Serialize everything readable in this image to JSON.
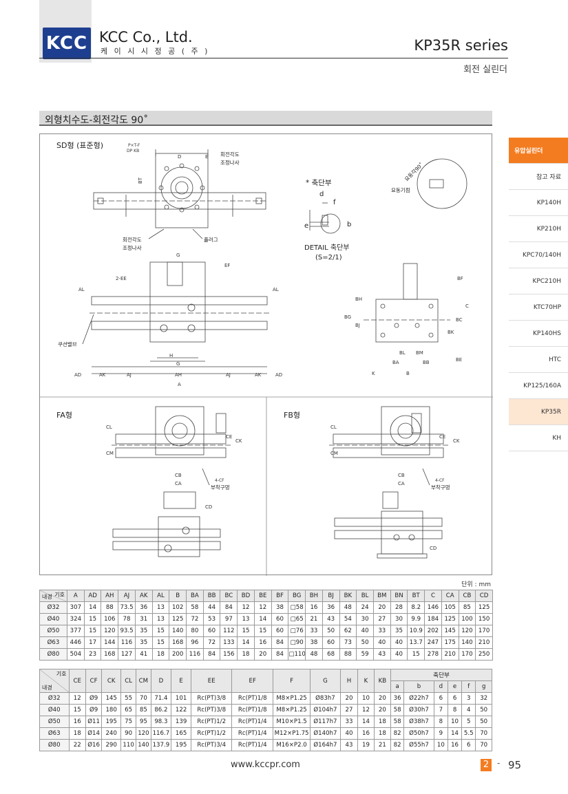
{
  "header": {
    "logo_text": "KCC",
    "company_name": "KCC Co., Ltd.",
    "company_korean": "케 이 시 시 정 공 ( 주 )",
    "series": "KP35R series",
    "series_sub": "회전 실린더"
  },
  "section_title": "외형치수도-회전각도 90˚",
  "drawing": {
    "sd_label": "SD형 (표준형)",
    "fa_label": "FA형",
    "fb_label": "FB형",
    "rot_adj_screw_1": "회전각도",
    "rot_adj_screw_2": "조정나사",
    "plug": "플러그",
    "cushion_valve": "쿠션밸브",
    "shaft_end": "* 축단부",
    "detail_1": "DETAIL 축단부",
    "detail_2": "(S=2/1)",
    "swing_range": "요동각90˚",
    "swing_ref": "요동기점",
    "mount_hole": "부착구멍",
    "dims": {
      "A": "A",
      "AD": "AD",
      "AK": "AK",
      "AJ": "AJ",
      "AH": "AH",
      "AL": "AL",
      "B": "B",
      "BA": "BA",
      "BB": "BB",
      "BC": "BC",
      "BD": "BD",
      "BE": "BE",
      "BF": "BF",
      "BG": "BG",
      "BH": "BH",
      "BJ": "BJ",
      "BK": "BK",
      "BL": "BL",
      "BM": "BM",
      "BN": "BN",
      "BT": "BT",
      "C": "C",
      "CA": "CA",
      "CB": "CB",
      "CD": "CD",
      "CE": "CE",
      "CF": "CF",
      "CK": "CK",
      "CL": "CL",
      "CM": "CM",
      "D": "D",
      "E": "E",
      "EE": "2-EE",
      "EF": "EF",
      "G": "G",
      "H": "H",
      "K": "K",
      "KB": "KB",
      "a": "a",
      "b": "b",
      "d": "d",
      "e": "e",
      "f": "f",
      "pcd": "P×T-F",
      "dp": "DP KB",
      "fourcf": "4-CF"
    }
  },
  "unit_label": "단위 : mm",
  "table1": {
    "corner_top": "기호",
    "corner_bottom": "내경",
    "headers": [
      "A",
      "AD",
      "AH",
      "AJ",
      "AK",
      "AL",
      "B",
      "BA",
      "BB",
      "BC",
      "BD",
      "BE",
      "BF",
      "BG",
      "BH",
      "BJ",
      "BK",
      "BL",
      "BM",
      "BN",
      "BT",
      "C",
      "CA",
      "CB",
      "CD"
    ],
    "rows": [
      [
        "Ø32",
        "307",
        "14",
        "88",
        "73.5",
        "36",
        "13",
        "102",
        "58",
        "44",
        "84",
        "12",
        "12",
        "38",
        "□58",
        "16",
        "36",
        "48",
        "24",
        "20",
        "28",
        "8.2",
        "146",
        "105",
        "85",
        "125"
      ],
      [
        "Ø40",
        "324",
        "15",
        "106",
        "78",
        "31",
        "13",
        "125",
        "72",
        "53",
        "97",
        "13",
        "14",
        "60",
        "□65",
        "21",
        "43",
        "54",
        "30",
        "27",
        "30",
        "9.9",
        "184",
        "125",
        "100",
        "150"
      ],
      [
        "Ø50",
        "377",
        "15",
        "120",
        "93.5",
        "35",
        "15",
        "140",
        "80",
        "60",
        "112",
        "15",
        "15",
        "60",
        "□76",
        "33",
        "50",
        "62",
        "40",
        "33",
        "35",
        "10.9",
        "202",
        "145",
        "120",
        "170"
      ],
      [
        "Ø63",
        "446",
        "17",
        "144",
        "116",
        "35",
        "15",
        "168",
        "96",
        "72",
        "133",
        "14",
        "16",
        "84",
        "□90",
        "38",
        "60",
        "73",
        "50",
        "40",
        "40",
        "13.7",
        "247",
        "175",
        "140",
        "210"
      ],
      [
        "Ø80",
        "504",
        "23",
        "168",
        "127",
        "41",
        "18",
        "200",
        "116",
        "84",
        "156",
        "18",
        "20",
        "84",
        "□110",
        "48",
        "68",
        "88",
        "59",
        "43",
        "40",
        "15",
        "278",
        "210",
        "170",
        "250"
      ]
    ]
  },
  "table2": {
    "corner_top": "기호",
    "corner_bottom": "내경",
    "headers": [
      "CE",
      "CF",
      "CK",
      "CL",
      "CM",
      "D",
      "E",
      "EE",
      "EF",
      "F",
      "G",
      "H",
      "K",
      "KB"
    ],
    "shaft_group": "축단부",
    "shaft_headers": [
      "a",
      "b",
      "d",
      "e",
      "f",
      "g"
    ],
    "rows": [
      [
        "Ø32",
        "12",
        "Ø9",
        "145",
        "55",
        "70",
        "71.4",
        "101",
        "Rc(PT)3/8",
        "Rc(PT)1/8",
        "M8×P1.25",
        "Ø83h7",
        "20",
        "10",
        "20",
        "36",
        "Ø22h7",
        "6",
        "6",
        "3",
        "32"
      ],
      [
        "Ø40",
        "15",
        "Ø9",
        "180",
        "65",
        "85",
        "86.2",
        "122",
        "Rc(PT)3/8",
        "Rc(PT)1/8",
        "M8×P1.25",
        "Ø104h7",
        "27",
        "12",
        "20",
        "58",
        "Ø30h7",
        "7",
        "8",
        "4",
        "50"
      ],
      [
        "Ø50",
        "16",
        "Ø11",
        "195",
        "75",
        "95",
        "98.3",
        "139",
        "Rc(PT)1/2",
        "Rc(PT)1/4",
        "M10×P1.5",
        "Ø117h7",
        "33",
        "14",
        "18",
        "58",
        "Ø38h7",
        "8",
        "10",
        "5",
        "50"
      ],
      [
        "Ø63",
        "18",
        "Ø14",
        "240",
        "90",
        "120",
        "116.7",
        "165",
        "Rc(PT)1/2",
        "Rc(PT)1/4",
        "M12×P1.75",
        "Ø140h7",
        "40",
        "16",
        "18",
        "82",
        "Ø50h7",
        "9",
        "14",
        "5.5",
        "70"
      ],
      [
        "Ø80",
        "22",
        "Ø16",
        "290",
        "110",
        "140",
        "137.9",
        "195",
        "Rc(PT)3/4",
        "Rc(PT)1/4",
        "M16×P2.0",
        "Ø164h7",
        "43",
        "19",
        "21",
        "82",
        "Ø55h7",
        "10",
        "16",
        "6",
        "70"
      ]
    ]
  },
  "sidebar": [
    "유압실린더",
    "참고 자료",
    "KP140H",
    "KP210H",
    "KPC70/140H",
    "KPC210H",
    "KTC70HP",
    "KP140HS",
    "HTC",
    "KP125/160A",
    "KP35R",
    "KH"
  ],
  "footer": {
    "url": "www.kccpr.com",
    "chapter": "2",
    "dash": "-",
    "page": "95"
  },
  "colors": {
    "logo_blue": "#1e3f8f",
    "accent_orange": "#f47c20",
    "current_highlight": "#fde6d2"
  }
}
